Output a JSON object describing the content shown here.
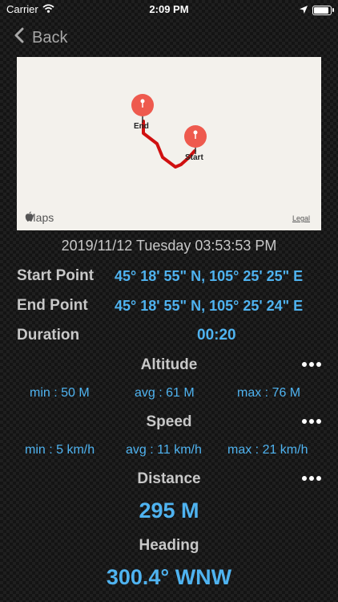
{
  "status_bar": {
    "carrier": "Carrier",
    "time": "2:09 PM"
  },
  "nav": {
    "back_label": "Back"
  },
  "map": {
    "start_label": "Start",
    "end_label": "End",
    "brand": "Maps",
    "legal": "Legal",
    "route_color": "#d01010",
    "pin_color": "#ee5a4e"
  },
  "trip": {
    "date": "2019/11/12 Tuesday 03:53:53 PM",
    "start_point_label": "Start Point",
    "start_point_value": "45° 18' 55\" N, 105° 25' 25\" E",
    "end_point_label": "End Point",
    "end_point_value": "45° 18' 55\" N, 105° 25' 24\" E",
    "duration_label": "Duration",
    "duration_value": "00:20"
  },
  "altitude": {
    "title": "Altitude",
    "min": "min : 50 M",
    "avg": "avg : 61 M",
    "max": "max : 76 M"
  },
  "speed": {
    "title": "Speed",
    "min": "min : 5 km/h",
    "avg": "avg : 11 km/h",
    "max": "max : 21 km/h"
  },
  "distance": {
    "title": "Distance",
    "value": "295 M"
  },
  "heading": {
    "title": "Heading",
    "value": "300.4° WNW"
  },
  "colors": {
    "accent": "#4fb3f0",
    "label": "#c8c8c8"
  }
}
